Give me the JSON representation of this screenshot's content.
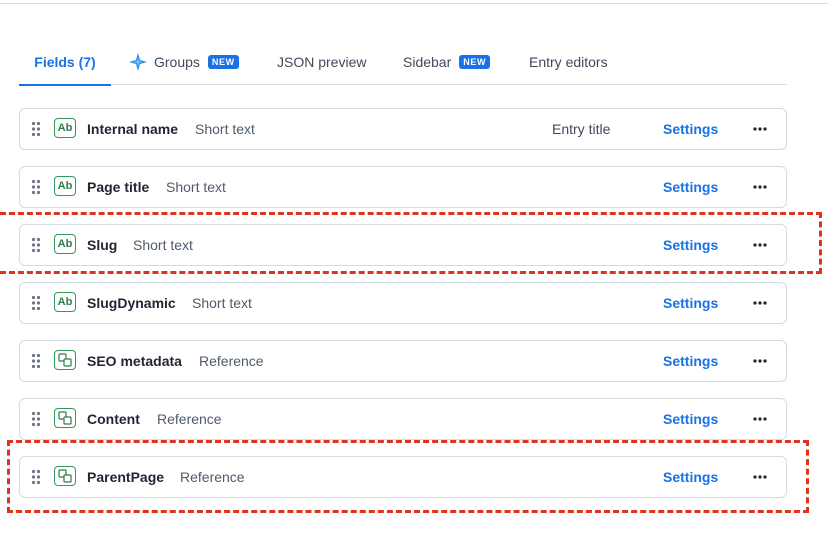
{
  "tabs": [
    {
      "label": "Fields (7)",
      "active": true
    },
    {
      "label": "Groups",
      "badge": "NEW",
      "icon": "groups-sparkle-icon"
    },
    {
      "label": "JSON preview"
    },
    {
      "label": "Sidebar",
      "badge": "NEW"
    },
    {
      "label": "Entry editors"
    }
  ],
  "fields": [
    {
      "name": "Internal name",
      "type": "Short text",
      "icon": "text-field-icon",
      "icon_text": "Ab",
      "entry_title_label": "Entry title",
      "settings_label": "Settings",
      "more_label": "•••"
    },
    {
      "name": "Page title",
      "type": "Short text",
      "icon": "text-field-icon",
      "icon_text": "Ab",
      "settings_label": "Settings",
      "more_label": "•••"
    },
    {
      "name": "Slug",
      "type": "Short text",
      "icon": "text-field-icon",
      "icon_text": "Ab",
      "settings_label": "Settings",
      "more_label": "•••"
    },
    {
      "name": "SlugDynamic",
      "type": "Short text",
      "icon": "text-field-icon",
      "icon_text": "Ab",
      "settings_label": "Settings",
      "more_label": "•••"
    },
    {
      "name": "SEO metadata",
      "type": "Reference",
      "icon": "reference-field-icon",
      "settings_label": "Settings",
      "more_label": "•••"
    },
    {
      "name": "Content",
      "type": "Reference",
      "icon": "reference-field-icon",
      "settings_label": "Settings",
      "more_label": "•••"
    },
    {
      "name": "ParentPage",
      "type": "Reference",
      "icon": "reference-field-icon",
      "settings_label": "Settings",
      "more_label": "•••"
    }
  ],
  "colors": {
    "accent": "#1872e6",
    "field_icon": "#2f9a5b",
    "highlight": "#e0331c"
  }
}
